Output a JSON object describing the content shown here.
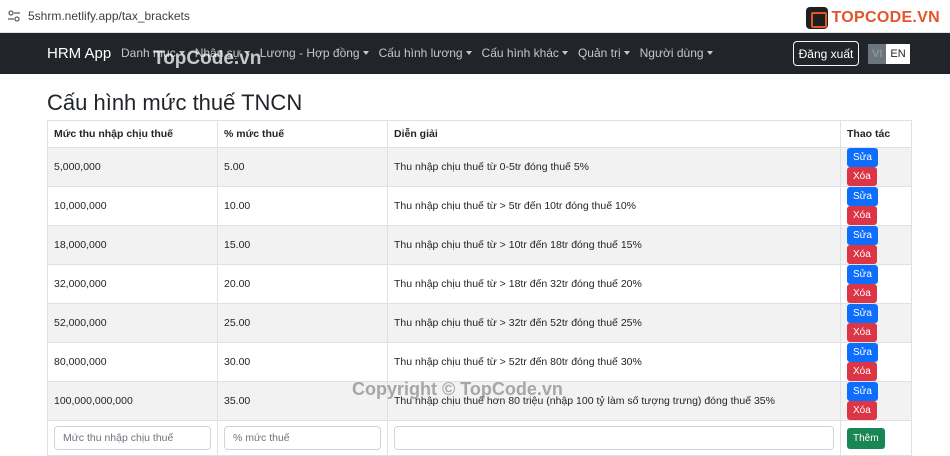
{
  "browser": {
    "url": "5shrm.netlify.app/tax_brackets"
  },
  "watermark": {
    "logo_text": "TOPCODE.VN",
    "top_text": "TopCode.vn",
    "bottom_text": "Copyright © TopCode.vn"
  },
  "navbar": {
    "brand": "HRM App",
    "items": [
      {
        "label": "Danh mục"
      },
      {
        "label": "Nhân sự"
      },
      {
        "label": "Lương - Hợp đồng"
      },
      {
        "label": "Cấu hình lương"
      },
      {
        "label": "Cấu hình khác"
      },
      {
        "label": "Quản trị"
      },
      {
        "label": "Người dùng"
      }
    ],
    "logout": "Đăng xuất",
    "lang_vi": "VI",
    "lang_en": "EN"
  },
  "page": {
    "title": "Cấu hình mức thuế TNCN"
  },
  "table": {
    "headers": [
      "Mức thu nhập chịu thuế",
      "% mức thuế",
      "Diễn giải",
      "Thao tác"
    ],
    "rows": [
      {
        "income": "5,000,000",
        "rate": "5.00",
        "desc": "Thu nhập chịu thuế từ 0-5tr đóng thuế 5%"
      },
      {
        "income": "10,000,000",
        "rate": "10.00",
        "desc": "Thu nhập chịu thuế từ > 5tr đến 10tr đóng thuế 10%"
      },
      {
        "income": "18,000,000",
        "rate": "15.00",
        "desc": "Thu nhập chịu thuế từ > 10tr đến 18tr đóng thuế 15%"
      },
      {
        "income": "32,000,000",
        "rate": "20.00",
        "desc": "Thu nhập chịu thuế từ > 18tr đến 32tr đóng thuế 20%"
      },
      {
        "income": "52,000,000",
        "rate": "25.00",
        "desc": "Thu nhập chịu thuế từ > 32tr đến 52tr đóng thuế 25%"
      },
      {
        "income": "80,000,000",
        "rate": "30.00",
        "desc": "Thu nhập chịu thuế từ > 52tr đến 80tr đóng thuế 30%"
      },
      {
        "income": "100,000,000,000",
        "rate": "35.00",
        "desc": "Thu nhập chịu thuế hơn 80 triệu (nhập 100 tỷ làm số tượng trưng) đóng thuế 35%"
      }
    ],
    "edit_label": "Sửa",
    "delete_label": "Xóa",
    "add_label": "Thêm",
    "placeholders": {
      "income": "Mức thu nhập chịu thuế",
      "rate": "% mức thuế",
      "desc": ""
    }
  },
  "colors": {
    "navbar": "#212529",
    "edit": "#0d6efd",
    "delete": "#dc3545",
    "add": "#198754"
  }
}
